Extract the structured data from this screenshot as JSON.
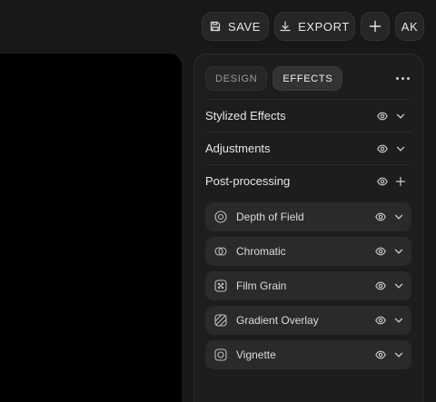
{
  "toolbar": {
    "save_label": "SAVE",
    "export_label": "EXPORT",
    "avatar_initials": "AK"
  },
  "panel": {
    "tabs": [
      {
        "label": "DESIGN",
        "active": false
      },
      {
        "label": "EFFECTS",
        "active": true
      }
    ],
    "sections": [
      {
        "title": "Stylized Effects",
        "icons": [
          "eye-icon",
          "chevron-down-icon"
        ]
      },
      {
        "title": "Adjustments",
        "icons": [
          "eye-icon",
          "chevron-down-icon"
        ]
      },
      {
        "title": "Post-processing",
        "icons": [
          "eye-icon",
          "plus-icon"
        ]
      }
    ],
    "effects": [
      {
        "title": "Depth of Field",
        "icon": "aperture-icon"
      },
      {
        "title": "Chromatic",
        "icon": "overlap-circles-icon"
      },
      {
        "title": "Film Grain",
        "icon": "grain-icon"
      },
      {
        "title": "Gradient Overlay",
        "icon": "gradient-icon"
      },
      {
        "title": "Vignette",
        "icon": "vignette-icon"
      }
    ]
  },
  "colors": {
    "background": "#181818",
    "panel": "#1d1d1d",
    "viewport": "#000000",
    "effect_row": "#2a2a2a",
    "active_tab": "#333333"
  }
}
